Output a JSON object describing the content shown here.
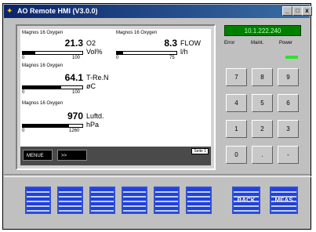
{
  "window": {
    "title": "AO Remote HMI (V3.0.0)",
    "controls": {
      "minimize": "_",
      "maximize": "□",
      "close": "x"
    }
  },
  "screen": {
    "sensors": [
      {
        "header": "Magnos 16 Oxygen",
        "value": "21.3",
        "unit_line1": "O2",
        "unit_line2": "Vol%",
        "scale_min": "0",
        "scale_max": "100",
        "fill": 0.21
      },
      {
        "header": "Magnos 16 Oxygen",
        "value": "8.3",
        "unit_line1": "FLOW",
        "unit_line2": "l/h",
        "scale_min": "0",
        "scale_max": "75",
        "fill": 0.11
      },
      {
        "header": "Magnos 16 Oxygen",
        "value": "64.1",
        "unit_line1": "T-Re.N",
        "unit_line2": "øC",
        "scale_min": "0",
        "scale_max": "100",
        "fill": 0.64
      },
      {
        "header": "Magnos 16 Oxygen",
        "value": "970",
        "unit_line1": "Luftd.",
        "unit_line2": "hPa",
        "scale_min": "0",
        "scale_max": "1260",
        "fill": 0.77
      }
    ],
    "page_label": "Seite 1",
    "softkeys": {
      "menu": "MENUE",
      "next": ">>"
    }
  },
  "status": {
    "ip": "10.1.222.240",
    "leds": [
      {
        "label": "Error",
        "color": ""
      },
      {
        "label": "Maint.",
        "color": ""
      },
      {
        "label": "Power",
        "color": "#30e030"
      }
    ]
  },
  "keypad": {
    "rows": [
      [
        "7",
        "8",
        "9"
      ],
      [
        "4",
        "5",
        "6"
      ],
      [
        "1",
        "2",
        "3"
      ],
      [
        "0",
        ".",
        "-"
      ]
    ]
  },
  "function_keys": {
    "back_label": "BACK",
    "meas_label": "MEAS"
  },
  "colors": {
    "titlebar": "#0a246a",
    "ip_box": "#008000",
    "fkey_blue": "#2040e0"
  }
}
